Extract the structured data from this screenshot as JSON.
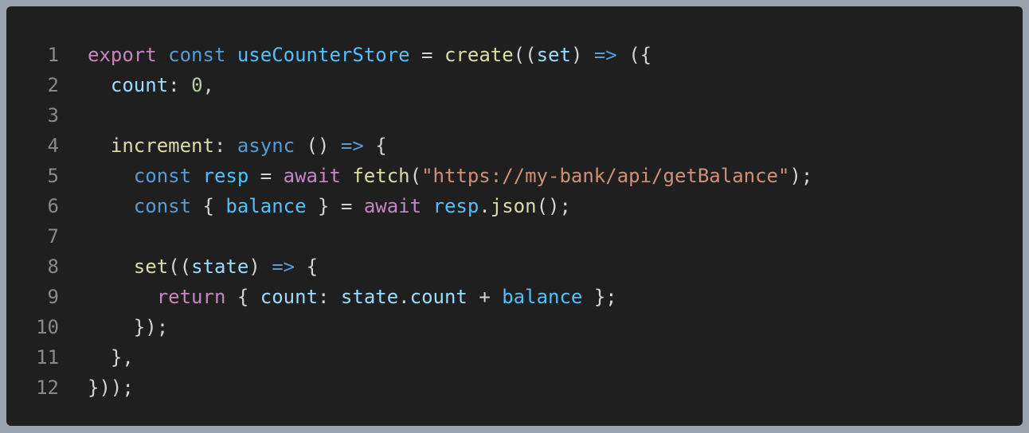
{
  "colors": {
    "background": "#1f1f1f",
    "line_number": "#8a8a8a",
    "keyword": "#c586c0",
    "storage": "#569cd6",
    "function": "#dcdcaa",
    "variable": "#9cdcfe",
    "constant": "#4fc1ff",
    "number": "#b5cea8",
    "string": "#ce9178",
    "punctuation": "#d4d4d4"
  },
  "editor": {
    "lines": [
      {
        "n": "1",
        "tokens": [
          {
            "t": "export",
            "c": "kw"
          },
          {
            "t": " ",
            "c": "pun"
          },
          {
            "t": "const",
            "c": "st"
          },
          {
            "t": " ",
            "c": "pun"
          },
          {
            "t": "useCounterStore",
            "c": "const"
          },
          {
            "t": " = ",
            "c": "pun"
          },
          {
            "t": "create",
            "c": "fn"
          },
          {
            "t": "((",
            "c": "pun"
          },
          {
            "t": "set",
            "c": "var"
          },
          {
            "t": ") ",
            "c": "pun"
          },
          {
            "t": "=>",
            "c": "st"
          },
          {
            "t": " ({",
            "c": "pun"
          }
        ]
      },
      {
        "n": "2",
        "tokens": [
          {
            "t": "  ",
            "c": "pun"
          },
          {
            "t": "count",
            "c": "var"
          },
          {
            "t": ": ",
            "c": "pun"
          },
          {
            "t": "0",
            "c": "num"
          },
          {
            "t": ",",
            "c": "pun"
          }
        ]
      },
      {
        "n": "3",
        "tokens": []
      },
      {
        "n": "4",
        "tokens": [
          {
            "t": "  ",
            "c": "pun"
          },
          {
            "t": "increment",
            "c": "fn"
          },
          {
            "t": ": ",
            "c": "pun"
          },
          {
            "t": "async",
            "c": "st"
          },
          {
            "t": " () ",
            "c": "pun"
          },
          {
            "t": "=>",
            "c": "st"
          },
          {
            "t": " {",
            "c": "pun"
          }
        ]
      },
      {
        "n": "5",
        "tokens": [
          {
            "t": "    ",
            "c": "pun"
          },
          {
            "t": "const",
            "c": "st"
          },
          {
            "t": " ",
            "c": "pun"
          },
          {
            "t": "resp",
            "c": "const"
          },
          {
            "t": " = ",
            "c": "pun"
          },
          {
            "t": "await",
            "c": "kw"
          },
          {
            "t": " ",
            "c": "pun"
          },
          {
            "t": "fetch",
            "c": "fn"
          },
          {
            "t": "(",
            "c": "pun"
          },
          {
            "t": "\"https://my-bank/api/getBalance\"",
            "c": "str"
          },
          {
            "t": ");",
            "c": "pun"
          }
        ]
      },
      {
        "n": "6",
        "tokens": [
          {
            "t": "    ",
            "c": "pun"
          },
          {
            "t": "const",
            "c": "st"
          },
          {
            "t": " { ",
            "c": "pun"
          },
          {
            "t": "balance",
            "c": "const"
          },
          {
            "t": " } = ",
            "c": "pun"
          },
          {
            "t": "await",
            "c": "kw"
          },
          {
            "t": " ",
            "c": "pun"
          },
          {
            "t": "resp",
            "c": "const"
          },
          {
            "t": ".",
            "c": "pun"
          },
          {
            "t": "json",
            "c": "fn"
          },
          {
            "t": "();",
            "c": "pun"
          }
        ]
      },
      {
        "n": "7",
        "tokens": []
      },
      {
        "n": "8",
        "tokens": [
          {
            "t": "    ",
            "c": "pun"
          },
          {
            "t": "set",
            "c": "fn"
          },
          {
            "t": "((",
            "c": "pun"
          },
          {
            "t": "state",
            "c": "var"
          },
          {
            "t": ") ",
            "c": "pun"
          },
          {
            "t": "=>",
            "c": "st"
          },
          {
            "t": " {",
            "c": "pun"
          }
        ]
      },
      {
        "n": "9",
        "tokens": [
          {
            "t": "      ",
            "c": "pun"
          },
          {
            "t": "return",
            "c": "kw"
          },
          {
            "t": " { ",
            "c": "pun"
          },
          {
            "t": "count",
            "c": "var"
          },
          {
            "t": ": ",
            "c": "pun"
          },
          {
            "t": "state",
            "c": "var"
          },
          {
            "t": ".",
            "c": "pun"
          },
          {
            "t": "count",
            "c": "var"
          },
          {
            "t": " + ",
            "c": "pun"
          },
          {
            "t": "balance",
            "c": "const"
          },
          {
            "t": " };",
            "c": "pun"
          }
        ]
      },
      {
        "n": "10",
        "tokens": [
          {
            "t": "    });",
            "c": "pun"
          }
        ]
      },
      {
        "n": "11",
        "tokens": [
          {
            "t": "  },",
            "c": "pun"
          }
        ]
      },
      {
        "n": "12",
        "tokens": [
          {
            "t": "}));",
            "c": "pun"
          }
        ]
      }
    ]
  }
}
